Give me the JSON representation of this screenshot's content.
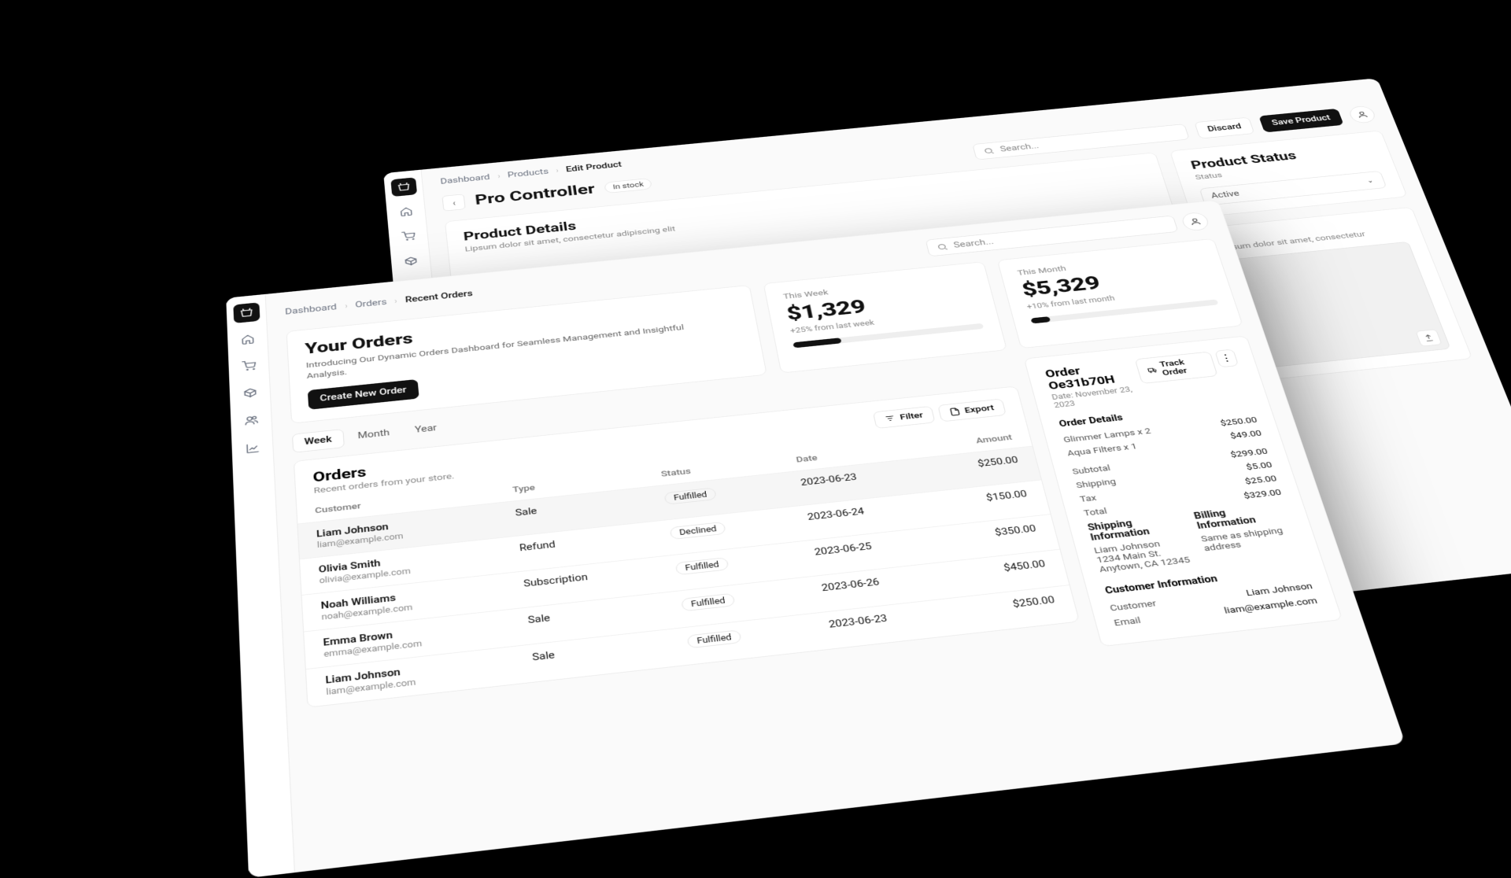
{
  "back": {
    "crumbs": [
      "Dashboard",
      "Products",
      "Edit Product"
    ],
    "title": "Pro Controller",
    "stock_badge": "In stock",
    "search_placeholder": "Search...",
    "discard": "Discard",
    "save": "Save Product",
    "details_title": "Product Details",
    "details_sub": "Lipsum dolor sit amet, consectetur adipiscing elit",
    "status_title": "Product Status",
    "status_label": "Status",
    "status_value": "Active",
    "rightnote": "Lipsum dolor sit amet, consectetur"
  },
  "front": {
    "crumbs": [
      "Dashboard",
      "Orders",
      "Recent Orders"
    ],
    "search_placeholder": "Search...",
    "hero_title": "Your Orders",
    "hero_body": "Introducing Our Dynamic Orders Dashboard for Seamless Management and Insightful Analysis.",
    "hero_cta": "Create New Order",
    "stats": [
      {
        "label": "This Week",
        "value": "$1,329",
        "delta": "+25% from last week",
        "pct": 25
      },
      {
        "label": "This Month",
        "value": "$5,329",
        "delta": "+10% from last month",
        "pct": 10
      }
    ],
    "tabs": [
      "Week",
      "Month",
      "Year"
    ],
    "orders_title": "Orders",
    "orders_sub": "Recent orders from your store.",
    "filter": "Filter",
    "export": "Export",
    "columns": {
      "customer": "Customer",
      "type": "Type",
      "status": "Status",
      "date": "Date",
      "amount": "Amount"
    },
    "rows": [
      {
        "name": "Liam Johnson",
        "mail": "liam@example.com",
        "type": "Sale",
        "status": "Fulfilled",
        "date": "2023-06-23",
        "amount": "$250.00",
        "sel": true
      },
      {
        "name": "Olivia Smith",
        "mail": "olivia@example.com",
        "type": "Refund",
        "status": "Declined",
        "date": "2023-06-24",
        "amount": "$150.00"
      },
      {
        "name": "Noah Williams",
        "mail": "noah@example.com",
        "type": "Subscription",
        "status": "Fulfilled",
        "date": "2023-06-25",
        "amount": "$350.00"
      },
      {
        "name": "Emma Brown",
        "mail": "emma@example.com",
        "type": "Sale",
        "status": "Fulfilled",
        "date": "2023-06-26",
        "amount": "$450.00"
      },
      {
        "name": "Liam Johnson",
        "mail": "liam@example.com",
        "type": "Sale",
        "status": "Fulfilled",
        "date": "2023-06-23",
        "amount": "$250.00"
      }
    ],
    "order": {
      "title": "Order Oe31b70H",
      "date": "Date: November 23, 2023",
      "track": "Track Order",
      "details_h": "Order Details",
      "items": [
        {
          "l": "Glimmer Lamps x 2",
          "r": "$250.00"
        },
        {
          "l": "Aqua Filters x 1",
          "r": "$49.00"
        }
      ],
      "totals": [
        {
          "l": "Subtotal",
          "r": "$299.00"
        },
        {
          "l": "Shipping",
          "r": "$5.00"
        },
        {
          "l": "Tax",
          "r": "$25.00"
        },
        {
          "l": "Total",
          "r": "$329.00"
        }
      ],
      "ship_h": "Shipping Information",
      "bill_h": "Billing Information",
      "ship_name": "Liam Johnson",
      "ship_a1": "1234 Main St.",
      "ship_a2": "Anytown, CA 12345",
      "bill_text": "Same as shipping address",
      "cust_h": "Customer Information",
      "cust_rows": [
        {
          "l": "Customer",
          "r": "Liam Johnson"
        },
        {
          "l": "Email",
          "r": "liam@example.com"
        }
      ]
    }
  }
}
